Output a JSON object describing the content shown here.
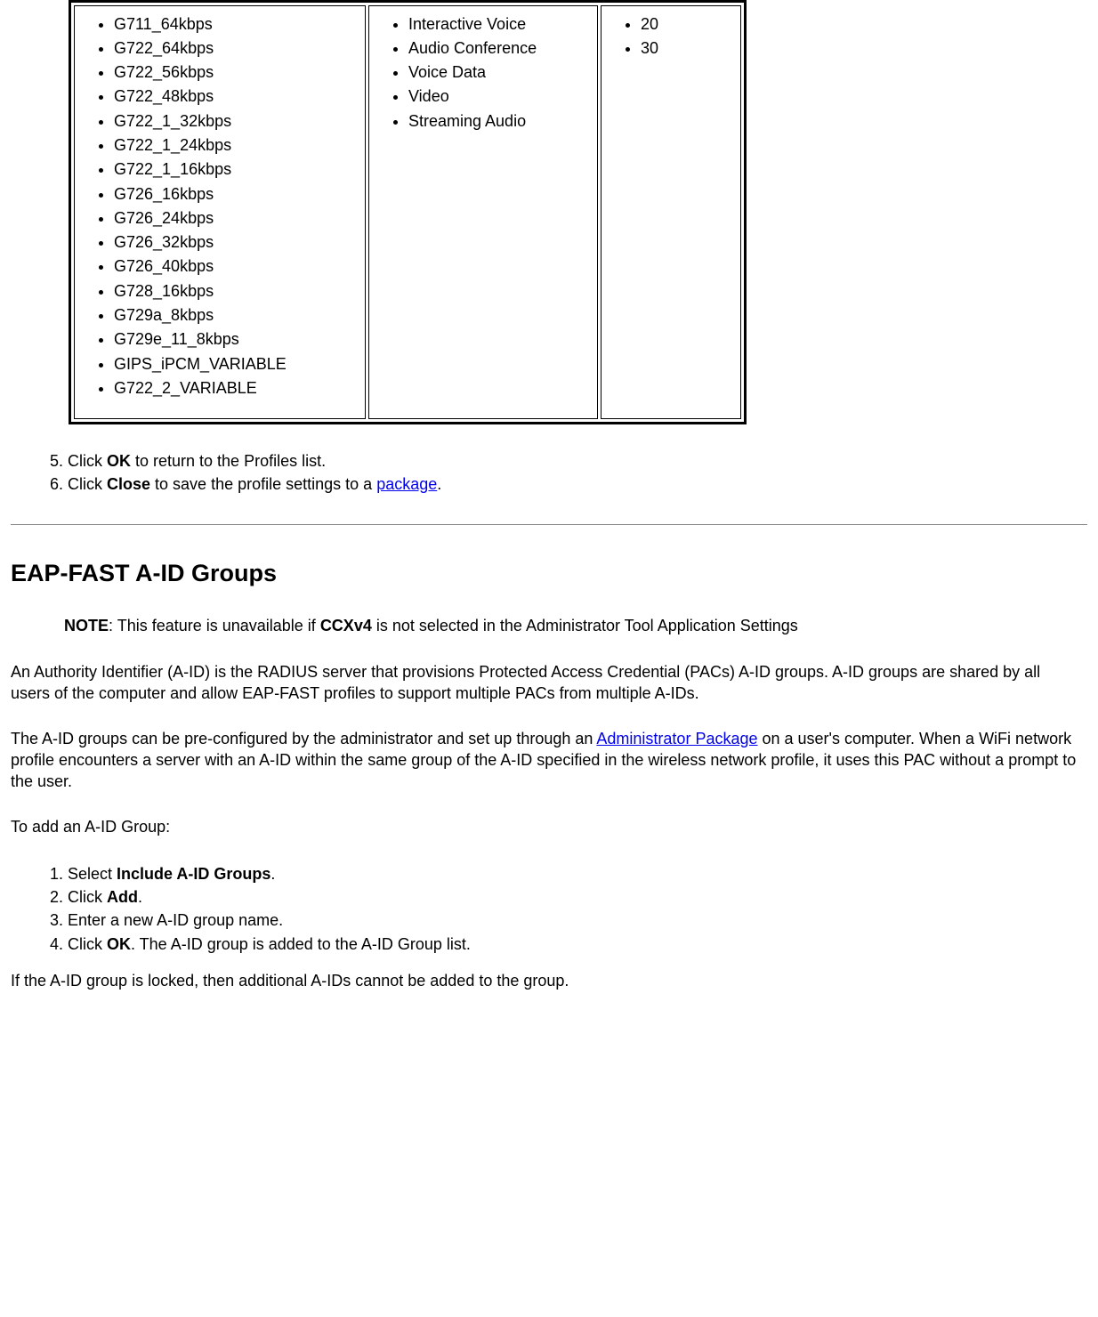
{
  "table": {
    "col1": [
      "G711_64kbps",
      "G722_64kbps",
      "G722_56kbps",
      "G722_48kbps",
      "G722_1_32kbps",
      "G722_1_24kbps",
      "G722_1_16kbps",
      "G726_16kbps",
      "G726_24kbps",
      "G726_32kbps",
      "G726_40kbps",
      "G728_16kbps",
      "G729a_8kbps",
      "G729e_11_8kbps",
      "GIPS_iPCM_VARIABLE",
      "G722_2_VARIABLE"
    ],
    "col2": [
      "Interactive Voice",
      "Audio Conference",
      "Voice Data",
      "Video",
      "Streaming Audio"
    ],
    "col3": [
      "20",
      "30"
    ]
  },
  "steps_top": {
    "s5_pre": "Click ",
    "s5_b": "OK",
    "s5_post": " to return to the Profiles list.",
    "s6_pre": "Click ",
    "s6_b": "Close",
    "s6_mid": " to save the profile settings to a ",
    "s6_link": "package",
    "s6_post": "."
  },
  "heading": "EAP-FAST A-ID Groups",
  "note": {
    "label": "NOTE",
    "pre": ": This feature is unavailable if ",
    "b": "CCXv4",
    "post": " is not selected in the Administrator Tool Application Settings"
  },
  "p1": "An Authority Identifier (A-ID) is the RADIUS server that provisions Protected Access Credential (PACs) A-ID groups. A-ID groups are shared by all users of the computer and allow EAP-FAST profiles to support multiple PACs from multiple A-IDs.",
  "p2_pre": "The A-ID groups can be pre-configured by the administrator and set up through an ",
  "p2_link": "Administrator Package",
  "p2_post": " on a user's computer. When a WiFi network profile encounters a server with an A-ID within the same group of the A-ID specified in the wireless network profile, it uses this PAC without a prompt to the user.",
  "p3": "To add an A-ID Group:",
  "steps_add": {
    "s1_pre": "Select ",
    "s1_b": "Include A-ID Groups",
    "s1_post": ".",
    "s2_pre": "Click ",
    "s2_b": "Add",
    "s2_post": ".",
    "s3": "Enter a new A-ID group name.",
    "s4_pre": "Click ",
    "s4_b": "OK",
    "s4_post": ". The A-ID group is added to the A-ID Group list."
  },
  "p4": "If the A-ID group is locked, then additional A-IDs cannot be added to the group."
}
